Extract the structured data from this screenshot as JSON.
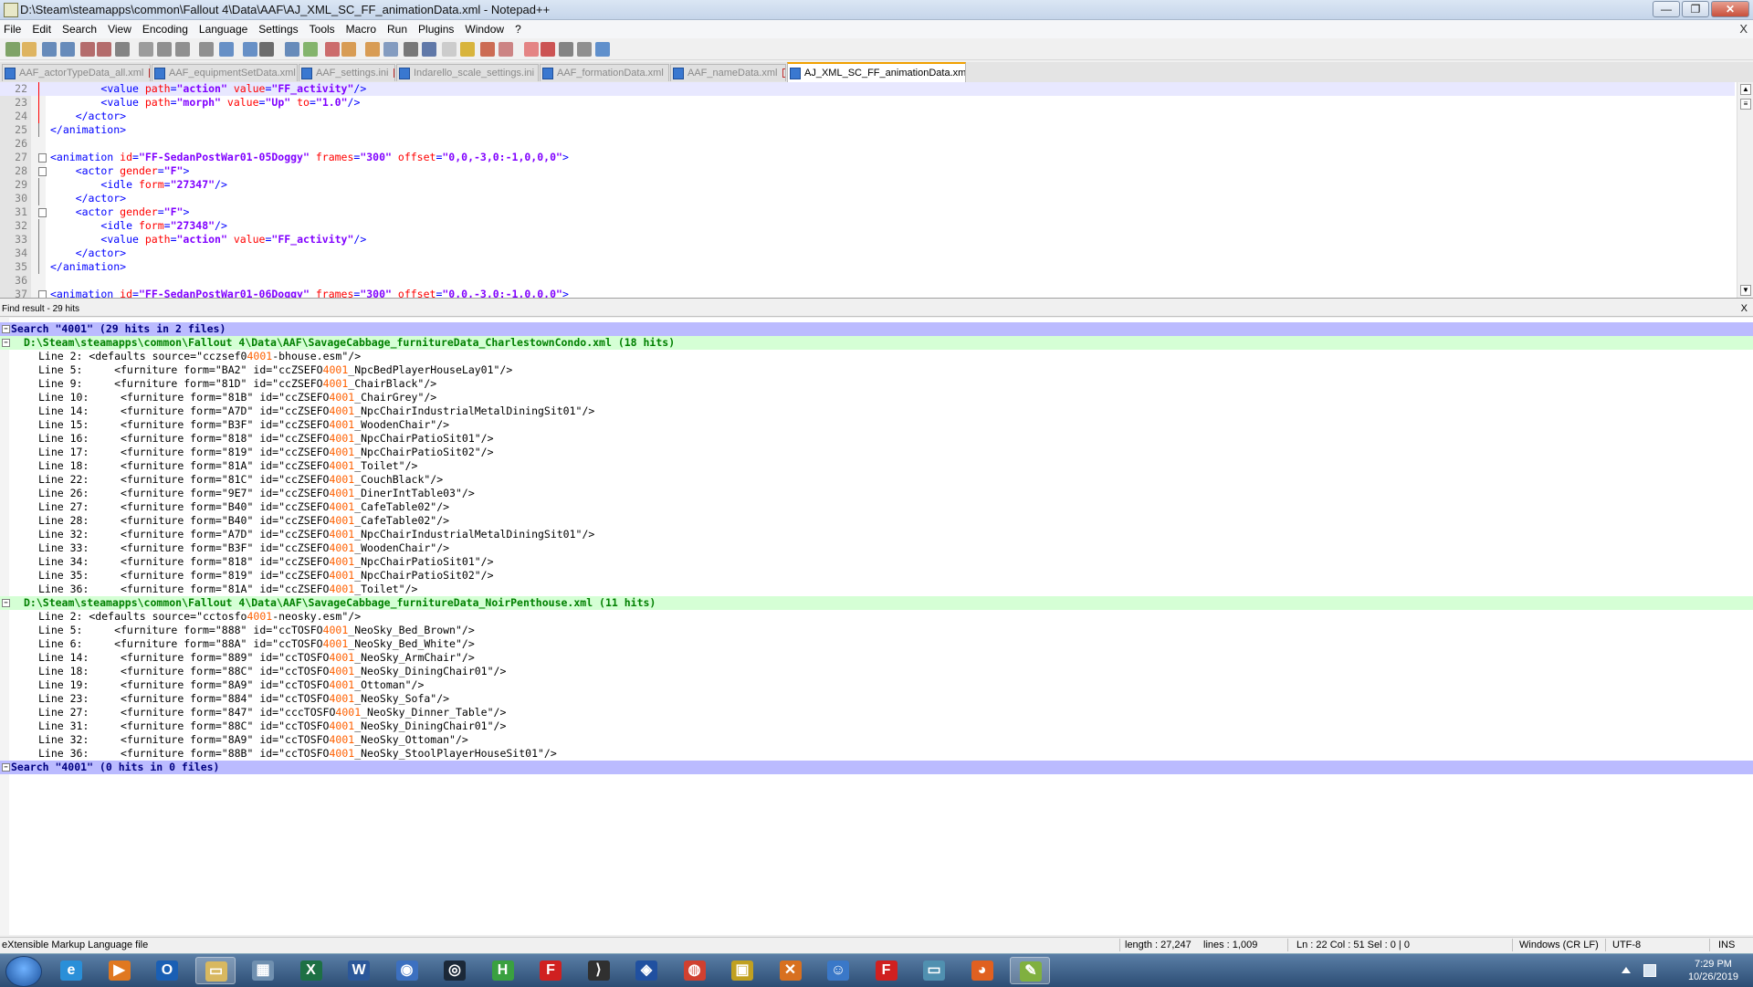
{
  "window": {
    "title": "D:\\Steam\\steamapps\\common\\Fallout 4\\Data\\AAF\\AJ_XML_SC_FF_animationData.xml - Notepad++",
    "minimize": "—",
    "maximize": "❐",
    "close": "✕"
  },
  "menu": {
    "items": [
      "File",
      "Edit",
      "Search",
      "View",
      "Encoding",
      "Language",
      "Settings",
      "Tools",
      "Macro",
      "Run",
      "Plugins",
      "Window",
      "?"
    ],
    "close": "X"
  },
  "tabs": [
    {
      "label": "AAF_actorTypeData_all.xml",
      "active": false
    },
    {
      "label": "AAF_equipmentSetData.xml",
      "active": false
    },
    {
      "label": "AAF_settings.ini",
      "active": false
    },
    {
      "label": "Indarello_scale_settings.ini",
      "active": false
    },
    {
      "label": "AAF_formationData.xml",
      "active": false
    },
    {
      "label": "AAF_nameData.xml",
      "active": false
    },
    {
      "label": "AJ_XML_SC_FF_animationData.xml",
      "active": true
    }
  ],
  "tab_close": "x",
  "editor": {
    "lines": [
      {
        "n": "22",
        "indent": "        ",
        "parts": [
          [
            "tag",
            "<value "
          ],
          [
            "attr",
            "path"
          ],
          [
            "tag",
            "="
          ],
          [
            "val",
            "\"action\""
          ],
          [
            "tag",
            " "
          ],
          [
            "attr",
            "value"
          ],
          [
            "tag",
            "="
          ],
          [
            "val",
            "\"FF_activity\""
          ],
          [
            "tag",
            "/>"
          ]
        ],
        "current": true
      },
      {
        "n": "23",
        "indent": "        ",
        "parts": [
          [
            "tag",
            "<value "
          ],
          [
            "attr",
            "path"
          ],
          [
            "tag",
            "="
          ],
          [
            "val",
            "\"morph\""
          ],
          [
            "tag",
            " "
          ],
          [
            "attr",
            "value"
          ],
          [
            "tag",
            "="
          ],
          [
            "val",
            "\"Up\""
          ],
          [
            "tag",
            " "
          ],
          [
            "attr",
            "to"
          ],
          [
            "tag",
            "="
          ],
          [
            "val",
            "\"1.0\""
          ],
          [
            "tag",
            "/>"
          ]
        ]
      },
      {
        "n": "24",
        "indent": "    ",
        "parts": [
          [
            "tag",
            "</actor>"
          ]
        ]
      },
      {
        "n": "25",
        "indent": "",
        "parts": [
          [
            "tag",
            "</animation>"
          ]
        ]
      },
      {
        "n": "26",
        "indent": "",
        "parts": []
      },
      {
        "n": "27",
        "indent": "",
        "parts": [
          [
            "tag",
            "<animation "
          ],
          [
            "attr",
            "id"
          ],
          [
            "tag",
            "="
          ],
          [
            "val",
            "\"FF-SedanPostWar01-05Doggy\""
          ],
          [
            "tag",
            " "
          ],
          [
            "attr",
            "frames"
          ],
          [
            "tag",
            "="
          ],
          [
            "val",
            "\"300\""
          ],
          [
            "tag",
            " "
          ],
          [
            "attr",
            "offset"
          ],
          [
            "tag",
            "="
          ],
          [
            "val",
            "\"0,0,-3,0:-1,0,0,0\""
          ],
          [
            "tag",
            ">"
          ]
        ]
      },
      {
        "n": "28",
        "indent": "    ",
        "parts": [
          [
            "tag",
            "<actor "
          ],
          [
            "attr",
            "gender"
          ],
          [
            "tag",
            "="
          ],
          [
            "val",
            "\"F\""
          ],
          [
            "tag",
            ">"
          ]
        ]
      },
      {
        "n": "29",
        "indent": "        ",
        "parts": [
          [
            "tag",
            "<idle "
          ],
          [
            "attr",
            "form"
          ],
          [
            "tag",
            "="
          ],
          [
            "val",
            "\"27347\""
          ],
          [
            "tag",
            "/>"
          ]
        ]
      },
      {
        "n": "30",
        "indent": "    ",
        "parts": [
          [
            "tag",
            "</actor>"
          ]
        ]
      },
      {
        "n": "31",
        "indent": "    ",
        "parts": [
          [
            "tag",
            "<actor "
          ],
          [
            "attr",
            "gender"
          ],
          [
            "tag",
            "="
          ],
          [
            "val",
            "\"F\""
          ],
          [
            "tag",
            ">"
          ]
        ]
      },
      {
        "n": "32",
        "indent": "        ",
        "parts": [
          [
            "tag",
            "<idle "
          ],
          [
            "attr",
            "form"
          ],
          [
            "tag",
            "="
          ],
          [
            "val",
            "\"27348\""
          ],
          [
            "tag",
            "/>"
          ]
        ]
      },
      {
        "n": "33",
        "indent": "        ",
        "parts": [
          [
            "tag",
            "<value "
          ],
          [
            "attr",
            "path"
          ],
          [
            "tag",
            "="
          ],
          [
            "val",
            "\"action\""
          ],
          [
            "tag",
            " "
          ],
          [
            "attr",
            "value"
          ],
          [
            "tag",
            "="
          ],
          [
            "val",
            "\"FF_activity\""
          ],
          [
            "tag",
            "/>"
          ]
        ]
      },
      {
        "n": "34",
        "indent": "    ",
        "parts": [
          [
            "tag",
            "</actor>"
          ]
        ]
      },
      {
        "n": "35",
        "indent": "",
        "parts": [
          [
            "tag",
            "</animation>"
          ]
        ]
      },
      {
        "n": "36",
        "indent": "",
        "parts": []
      },
      {
        "n": "37",
        "indent": "",
        "parts": [
          [
            "tag",
            "<animation "
          ],
          [
            "attr",
            "id"
          ],
          [
            "tag",
            "="
          ],
          [
            "val",
            "\"FF-SedanPostWar01-06Doggy\""
          ],
          [
            "tag",
            " "
          ],
          [
            "attr",
            "frames"
          ],
          [
            "tag",
            "="
          ],
          [
            "val",
            "\"300\""
          ],
          [
            "tag",
            " "
          ],
          [
            "attr",
            "offset"
          ],
          [
            "tag",
            "="
          ],
          [
            "val",
            "\"0,0,-3,0:-1,0,0,0\""
          ],
          [
            "tag",
            ">"
          ]
        ]
      }
    ]
  },
  "find_panel": {
    "title": "Find result - 29 hits",
    "close": "X",
    "lines": [
      {
        "type": "search",
        "text": "Search \"4001\" (29 hits in 2 files)"
      },
      {
        "type": "file",
        "text": "D:\\Steam\\steamapps\\common\\Fallout 4\\Data\\AAF\\SavageCabbage_furnitureData_CharlestownCondo.xml (18 hits)"
      },
      {
        "type": "hit",
        "pre": "Line 2: <defaults source=\"cczsef0",
        "hit": "4001",
        "post": "-bhouse.esm\"/>"
      },
      {
        "type": "hit",
        "pre": "Line 5:     <furniture form=\"BA2\" id=\"ccZSEFO",
        "hit": "4001",
        "post": "_NpcBedPlayerHouseLay01\"/>"
      },
      {
        "type": "hit",
        "pre": "Line 9:     <furniture form=\"81D\" id=\"ccZSEFO",
        "hit": "4001",
        "post": "_ChairBlack\"/>"
      },
      {
        "type": "hit",
        "pre": "Line 10:     <furniture form=\"81B\" id=\"ccZSEFO",
        "hit": "4001",
        "post": "_ChairGrey\"/>"
      },
      {
        "type": "hit",
        "pre": "Line 14:     <furniture form=\"A7D\" id=\"ccZSEFO",
        "hit": "4001",
        "post": "_NpcChairIndustrialMetalDiningSit01\"/>"
      },
      {
        "type": "hit",
        "pre": "Line 15:     <furniture form=\"B3F\" id=\"ccZSEFO",
        "hit": "4001",
        "post": "_WoodenChair\"/>"
      },
      {
        "type": "hit",
        "pre": "Line 16:     <furniture form=\"818\" id=\"ccZSEFO",
        "hit": "4001",
        "post": "_NpcChairPatioSit01\"/>"
      },
      {
        "type": "hit",
        "pre": "Line 17:     <furniture form=\"819\" id=\"ccZSEFO",
        "hit": "4001",
        "post": "_NpcChairPatioSit02\"/>"
      },
      {
        "type": "hit",
        "pre": "Line 18:     <furniture form=\"81A\" id=\"ccZSEFO",
        "hit": "4001",
        "post": "_Toilet\"/>"
      },
      {
        "type": "hit",
        "pre": "Line 22:     <furniture form=\"81C\" id=\"ccZSEFO",
        "hit": "4001",
        "post": "_CouchBlack\"/>"
      },
      {
        "type": "hit",
        "pre": "Line 26:     <furniture form=\"9E7\" id=\"ccZSEFO",
        "hit": "4001",
        "post": "_DinerIntTable03\"/>"
      },
      {
        "type": "hit",
        "pre": "Line 27:     <furniture form=\"B40\" id=\"ccZSEFO",
        "hit": "4001",
        "post": "_CafeTable02\"/>"
      },
      {
        "type": "hit",
        "pre": "Line 28:     <furniture form=\"B40\" id=\"ccZSEFO",
        "hit": "4001",
        "post": "_CafeTable02\"/>"
      },
      {
        "type": "hit",
        "pre": "Line 32:     <furniture form=\"A7D\" id=\"ccZSEFO",
        "hit": "4001",
        "post": "_NpcChairIndustrialMetalDiningSit01\"/>"
      },
      {
        "type": "hit",
        "pre": "Line 33:     <furniture form=\"B3F\" id=\"ccZSEFO",
        "hit": "4001",
        "post": "_WoodenChair\"/>"
      },
      {
        "type": "hit",
        "pre": "Line 34:     <furniture form=\"818\" id=\"ccZSEFO",
        "hit": "4001",
        "post": "_NpcChairPatioSit01\"/>"
      },
      {
        "type": "hit",
        "pre": "Line 35:     <furniture form=\"819\" id=\"ccZSEFO",
        "hit": "4001",
        "post": "_NpcChairPatioSit02\"/>"
      },
      {
        "type": "hit",
        "pre": "Line 36:     <furniture form=\"81A\" id=\"ccZSEFO",
        "hit": "4001",
        "post": "_Toilet\"/>"
      },
      {
        "type": "file",
        "text": "D:\\Steam\\steamapps\\common\\Fallout 4\\Data\\AAF\\SavageCabbage_furnitureData_NoirPenthouse.xml (11 hits)"
      },
      {
        "type": "hit",
        "pre": "Line 2: <defaults source=\"cctosfo",
        "hit": "4001",
        "post": "-neosky.esm\"/>"
      },
      {
        "type": "hit",
        "pre": "Line 5:     <furniture form=\"888\" id=\"ccTOSFO",
        "hit": "4001",
        "post": "_NeoSky_Bed_Brown\"/>"
      },
      {
        "type": "hit",
        "pre": "Line 6:     <furniture form=\"88A\" id=\"ccTOSFO",
        "hit": "4001",
        "post": "_NeoSky_Bed_White\"/>"
      },
      {
        "type": "hit",
        "pre": "Line 14:     <furniture form=\"889\" id=\"ccTOSFO",
        "hit": "4001",
        "post": "_NeoSky_ArmChair\"/>"
      },
      {
        "type": "hit",
        "pre": "Line 18:     <furniture form=\"88C\" id=\"ccTOSFO",
        "hit": "4001",
        "post": "_NeoSky_DiningChair01\"/>"
      },
      {
        "type": "hit",
        "pre": "Line 19:     <furniture form=\"8A9\" id=\"ccTOSFO",
        "hit": "4001",
        "post": "_Ottoman\"/>"
      },
      {
        "type": "hit",
        "pre": "Line 23:     <furniture form=\"884\" id=\"ccTOSFO",
        "hit": "4001",
        "post": "_NeoSky_Sofa\"/>"
      },
      {
        "type": "hit",
        "pre": "Line 27:     <furniture form=\"847\" id=\"cccTOSFO",
        "hit": "4001",
        "post": "_NeoSky_Dinner_Table\"/>"
      },
      {
        "type": "hit",
        "pre": "Line 31:     <furniture form=\"88C\" id=\"ccTOSFO",
        "hit": "4001",
        "post": "_NeoSky_DiningChair01\"/>"
      },
      {
        "type": "hit",
        "pre": "Line 32:     <furniture form=\"8A9\" id=\"ccTOSFO",
        "hit": "4001",
        "post": "_NeoSky_Ottoman\"/>"
      },
      {
        "type": "hit",
        "pre": "Line 36:     <furniture form=\"88B\" id=\"ccTOSFO",
        "hit": "4001",
        "post": "_NeoSky_StoolPlayerHouseSit01\"/>"
      },
      {
        "type": "search",
        "text": "Search \"4001\" (0 hits in 0 files)"
      }
    ]
  },
  "status": {
    "filetype": "eXtensible Markup Language file",
    "length": "length : 27,247",
    "lines": "lines : 1,009",
    "position": "Ln : 22    Col : 51    Sel : 0 | 0",
    "eol": "Windows (CR LF)",
    "encoding": "UTF-8",
    "mode": "INS"
  },
  "taskbar": {
    "apps": [
      {
        "name": "ie-icon",
        "color": "#2a8fd8",
        "glyph": "e"
      },
      {
        "name": "media-player-icon",
        "color": "#e07820",
        "glyph": "▶"
      },
      {
        "name": "outlook-icon",
        "color": "#1a5fb4",
        "glyph": "O"
      },
      {
        "name": "file-explorer-icon",
        "color": "#d8b860",
        "glyph": "▭",
        "active": true
      },
      {
        "name": "calculator-icon",
        "color": "#7090b0",
        "glyph": "▦"
      },
      {
        "name": "excel-icon",
        "color": "#1d7044",
        "glyph": "X"
      },
      {
        "name": "word-icon",
        "color": "#2b579a",
        "glyph": "W"
      },
      {
        "name": "globe-app-icon",
        "color": "#3c70c0",
        "glyph": "◉"
      },
      {
        "name": "steam-icon",
        "color": "#1b2838",
        "glyph": "◎"
      },
      {
        "name": "h-app-icon",
        "color": "#3aa040",
        "glyph": "H"
      },
      {
        "name": "f-app-icon",
        "color": "#d02020",
        "glyph": "F"
      },
      {
        "name": "bethesda-icon",
        "color": "#303030",
        "glyph": "⟩"
      },
      {
        "name": "shield-app-icon",
        "color": "#2050a0",
        "glyph": "◈"
      },
      {
        "name": "chrome-icon",
        "color": "#d04030",
        "glyph": "◍"
      },
      {
        "name": "note-app-icon",
        "color": "#c0a020",
        "glyph": "▣"
      },
      {
        "name": "x-app-icon",
        "color": "#d87020",
        "glyph": "✕"
      },
      {
        "name": "vault-boy-icon",
        "color": "#3a78c8",
        "glyph": "☺"
      },
      {
        "name": "f-app-2-icon",
        "color": "#d02020",
        "glyph": "F"
      },
      {
        "name": "monitor-app-icon",
        "color": "#5090b0",
        "glyph": "▭"
      },
      {
        "name": "firefox-icon",
        "color": "#e06020",
        "glyph": "◕"
      },
      {
        "name": "notepadpp-icon",
        "color": "#80b040",
        "glyph": "✎",
        "active": true
      }
    ],
    "time": "7:29 PM",
    "date": "10/26/2019"
  }
}
